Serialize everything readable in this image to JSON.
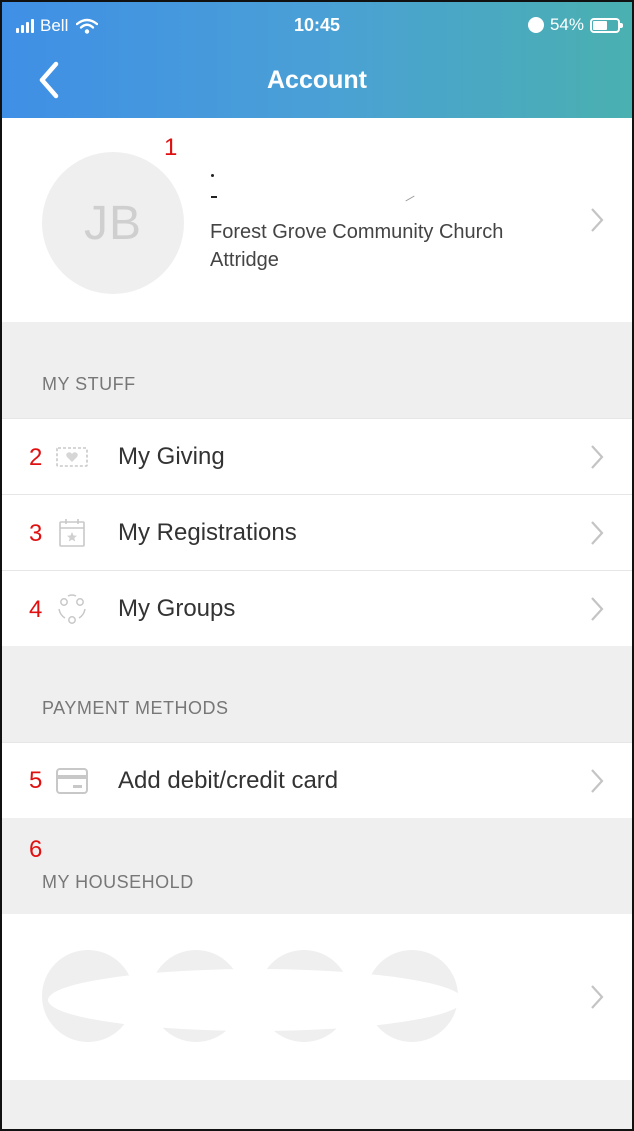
{
  "status_bar": {
    "carrier": "Bell",
    "time": "10:45",
    "battery": "54%",
    "battery_level": 0.54
  },
  "nav": {
    "title": "Account",
    "back_icon": "chevron-left-icon"
  },
  "profile": {
    "initials": "JB",
    "church_line1": "Forest Grove Community Church",
    "church_line2": "Attridge"
  },
  "sections": {
    "my_stuff": "MY STUFF",
    "payment_methods": "PAYMENT METHODS",
    "my_household": "MY HOUSEHOLD"
  },
  "rows": {
    "my_giving": {
      "label": "My Giving",
      "icon": "money-icon"
    },
    "my_registrations": {
      "label": "My Registrations",
      "icon": "calendar-icon"
    },
    "my_groups": {
      "label": "My Groups",
      "icon": "groups-icon"
    },
    "add_card": {
      "label": "Add debit/credit card",
      "icon": "credit-card-icon"
    }
  },
  "annotations": [
    "1",
    "2",
    "3",
    "4",
    "5",
    "6"
  ],
  "colors": {
    "header_start": "#3f8fe6",
    "header_end": "#4ab0b0",
    "annotation": "#e01010"
  }
}
